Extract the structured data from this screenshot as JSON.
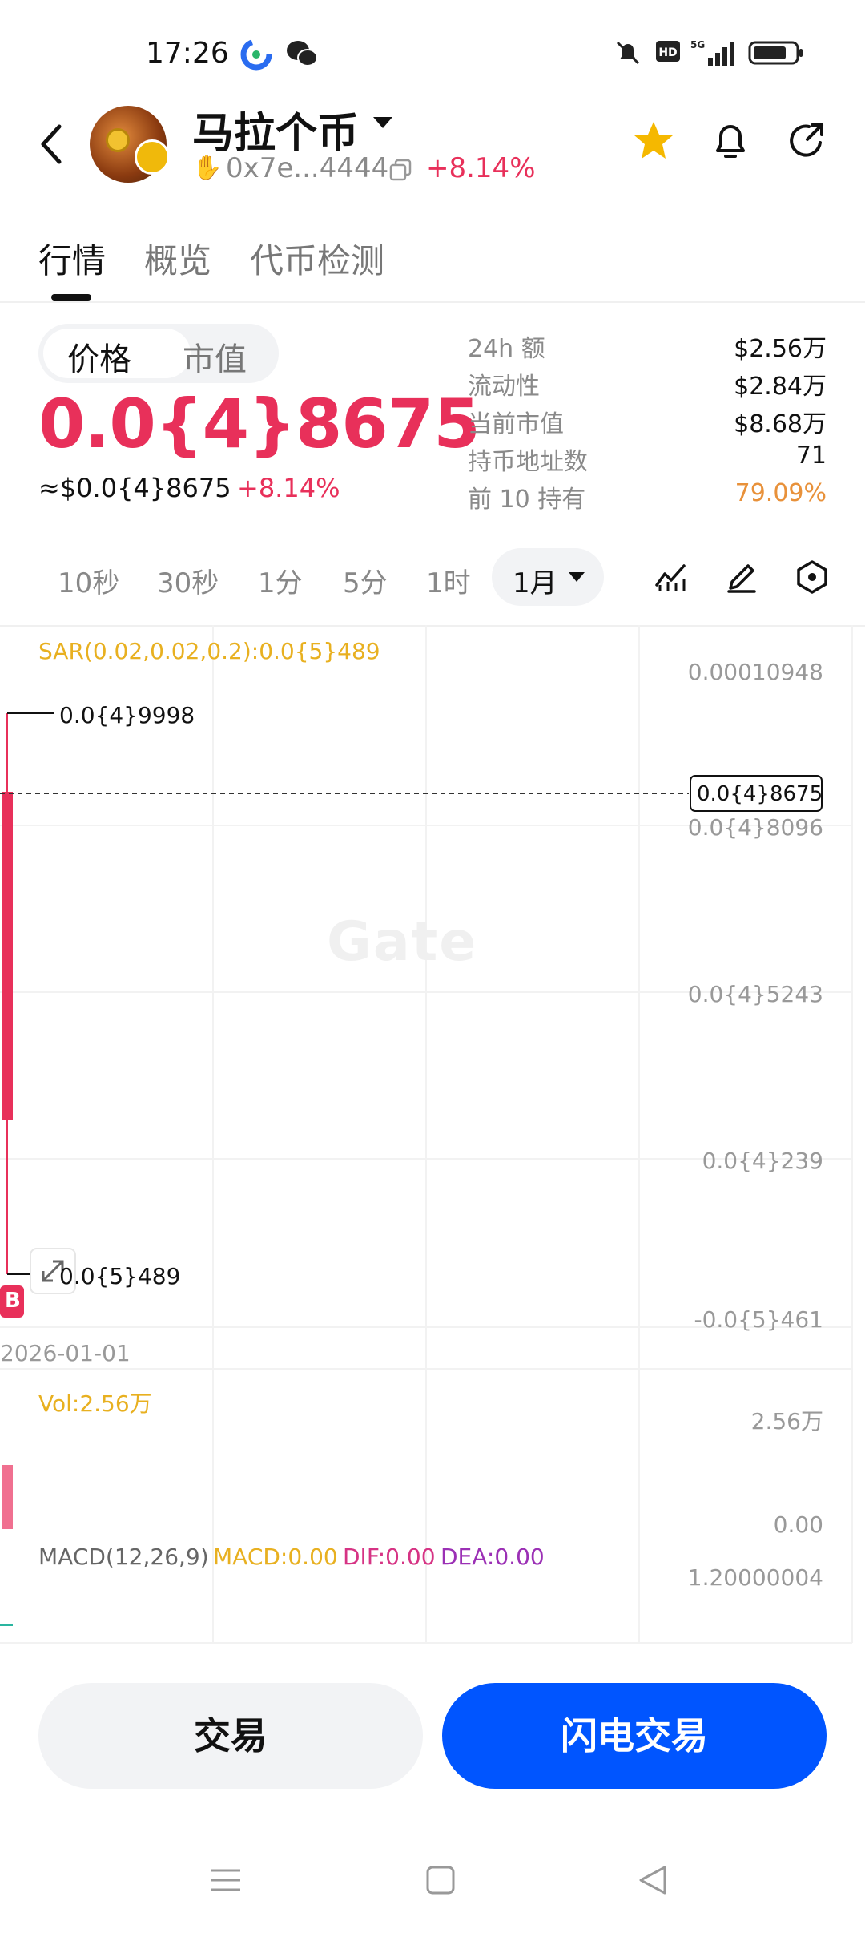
{
  "status_bar": {
    "time": "17:26",
    "network": "5G"
  },
  "header": {
    "coin_name": "马拉个币",
    "address": "0x7e...4444",
    "change": "+8.14%"
  },
  "tabs": [
    {
      "label": "行情",
      "active": true
    },
    {
      "label": "概览",
      "active": false
    },
    {
      "label": "代币检测",
      "active": false
    }
  ],
  "price_panel": {
    "toggle_price": "价格",
    "toggle_mcap": "市值",
    "price": "0.0{4}8675",
    "usd_price": "≈$0.0{4}8675",
    "usd_change": "+8.14%"
  },
  "stats": [
    {
      "label": "24h  额",
      "value": "$2.56万"
    },
    {
      "label": "流动性",
      "value": "$2.84万"
    },
    {
      "label": "当前市值",
      "value": "$8.68万"
    },
    {
      "label": "持币地址数",
      "value": "71"
    },
    {
      "label": "前 10 持有",
      "value": "79.09%"
    }
  ],
  "timeframes": [
    "10秒",
    "30秒",
    "1分",
    "5分",
    "1时"
  ],
  "active_timeframe": "1月",
  "chart": {
    "sar_label": "SAR(0.02,0.02,0.2):0.0{5}489",
    "high_label": "0.0{4}9998",
    "low_label": "0.0{5}489",
    "current_price_label": "0.0{4}8675",
    "y_ticks": [
      "0.00010948",
      "0.0{4}8096",
      "0.0{4}5243",
      "0.0{4}239",
      "-0.0{5}461"
    ],
    "x_tick": "2026-01-01",
    "buy_marker": "B",
    "watermark": "Gate",
    "vol_label": "Vol:2.56万",
    "vol_ticks": [
      "2.56万",
      "0.00"
    ],
    "macd_label": "MACD(12,26,9)",
    "macd_value": "MACD:0.00",
    "dif_value": "DIF:0.00",
    "dea_value": "DEA:0.00",
    "macd_tick": "1.20000004",
    "colors": {
      "up": "#e8305a",
      "sar": "#e8b020",
      "dif": "#d63384",
      "dea": "#9b30b5"
    }
  },
  "actions": {
    "trade": "交易",
    "flash_trade": "闪电交易"
  }
}
